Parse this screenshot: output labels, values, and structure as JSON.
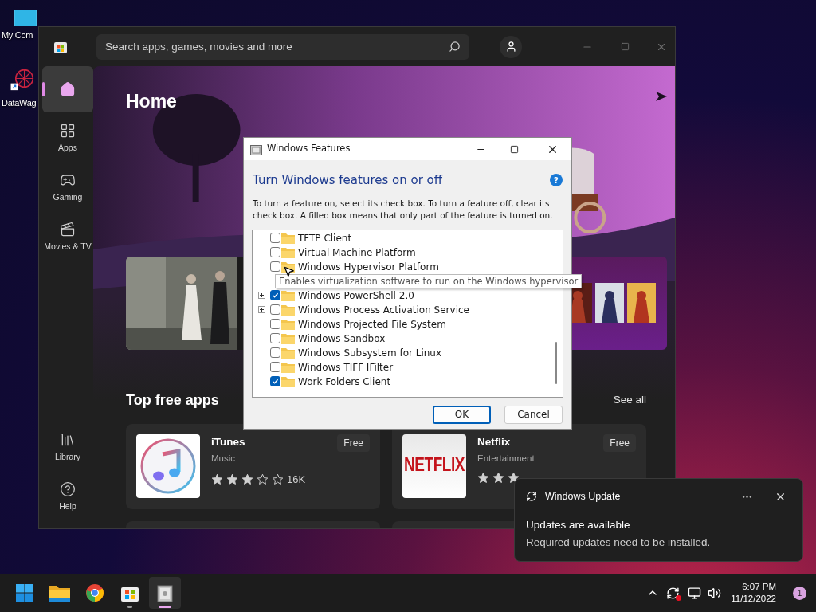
{
  "desktop_icons": [
    {
      "label": "My Com",
      "kind": "computer"
    },
    {
      "label": "DataWag",
      "kind": "shortcut"
    }
  ],
  "store": {
    "search": {
      "placeholder": "Search apps, games, movies and more"
    },
    "nav": [
      {
        "kind": "home",
        "selected": true
      },
      {
        "kind": "apps",
        "label": "Apps",
        "selected": false
      },
      {
        "kind": "gaming",
        "label": "Gaming",
        "selected": false
      },
      {
        "kind": "movies",
        "label": "Movies & TV",
        "selected": false
      },
      {
        "kind": "library",
        "label": "Library",
        "selected": false
      },
      {
        "kind": "help",
        "label": "Help",
        "selected": false
      }
    ],
    "page_title": "Home",
    "section_title": "Top free apps",
    "see_all": "See all",
    "apps": [
      {
        "kind": "itunes",
        "name": "iTunes",
        "category": "Music",
        "price": "Free",
        "stars": 3,
        "covered": false,
        "count": "16K"
      },
      {
        "kind": "netflix",
        "name": "Netflix",
        "category": "Entertainment",
        "price": "Free",
        "stars": 3,
        "covered": true,
        "logo_text": "NETFLIX"
      }
    ]
  },
  "dialog": {
    "title": "Windows Features",
    "heading": "Turn Windows features on or off",
    "help": "?",
    "description": "To turn a feature on, select its check box. To turn a feature off, clear its check box. A filled box means that only part of the feature is turned on.",
    "features": [
      {
        "label": "TFTP Client",
        "checked": false,
        "expandable": false,
        "hovered": false
      },
      {
        "label": "Virtual Machine Platform",
        "checked": false,
        "expandable": false,
        "hovered": false
      },
      {
        "label": "Windows Hypervisor Platform",
        "checked": false,
        "expandable": false,
        "hovered": true,
        "tooltip": "Enables virtualization software to run on the Windows hypervisor"
      },
      {
        "label": "Windows PowerShell 2.0",
        "checked": true,
        "expandable": true,
        "hovered": false
      },
      {
        "label": "Windows Process Activation Service",
        "checked": false,
        "expandable": true,
        "hovered": false
      },
      {
        "label": "Windows Projected File System",
        "checked": false,
        "expandable": false,
        "hovered": false
      },
      {
        "label": "Windows Sandbox",
        "checked": false,
        "expandable": false,
        "hovered": false
      },
      {
        "label": "Windows Subsystem for Linux",
        "checked": false,
        "expandable": false,
        "hovered": false
      },
      {
        "label": "Windows TIFF IFilter",
        "checked": false,
        "expandable": false,
        "hovered": false
      },
      {
        "label": "Work Folders Client",
        "checked": true,
        "expandable": false,
        "hovered": false
      }
    ],
    "buttons": [
      {
        "label": "OK",
        "default": true
      },
      {
        "label": "Cancel",
        "default": false
      }
    ]
  },
  "notification": {
    "app": "Windows Update",
    "title": "Updates are available",
    "body": "Required updates need to be installed."
  },
  "taskbar": {
    "apps": [
      {
        "kind": "start",
        "running": false,
        "active": false
      },
      {
        "kind": "explorer",
        "running": false,
        "active": false
      },
      {
        "kind": "chrome",
        "running": false,
        "active": false
      },
      {
        "kind": "store",
        "running": true,
        "active": false
      },
      {
        "kind": "features",
        "running": true,
        "active": true
      }
    ],
    "time": "6:07 PM",
    "date": "11/12/2022",
    "badge": "1"
  }
}
